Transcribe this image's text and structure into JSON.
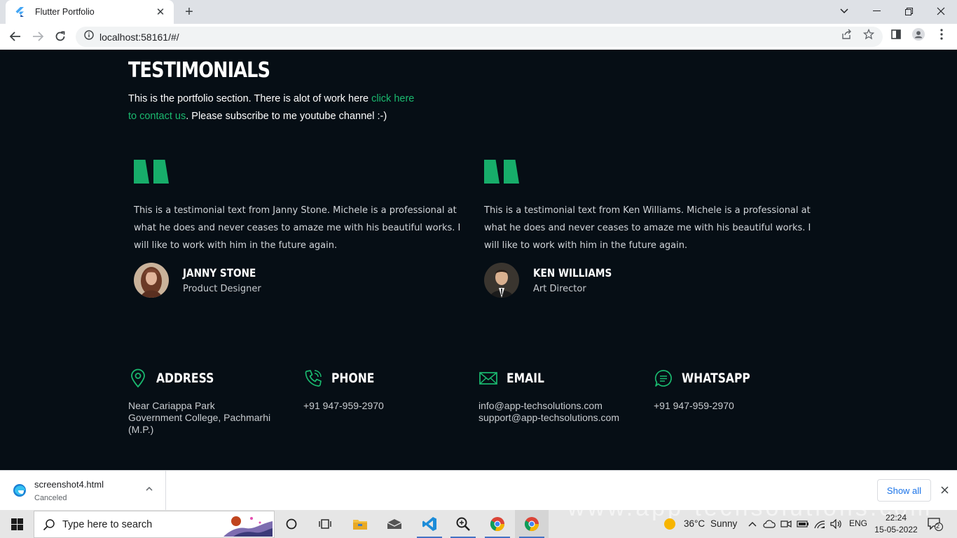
{
  "browser": {
    "tab_title": "Flutter Portfolio",
    "new_tab": "+",
    "url": "localhost:58161/#/"
  },
  "page": {
    "section_title": "TESTIMONIALS",
    "intro_before": "This is the portfolio section. There is alot of work here ",
    "intro_link": "click here to contact us",
    "intro_after": ". Please subscribe to me youtube channel :-)",
    "testimonials": [
      {
        "text": "This is a testimonial text from Janny Stone. Michele is a professional at what he does and never ceases to amaze me with his beautiful works. I will like to work with him in the future again.",
        "name": "JANNY STONE",
        "role": "Product Designer"
      },
      {
        "text": "This is a testimonial text from Ken Williams. Michele is a professional at what he does and never ceases to amaze me with his beautiful works. I will like to work with him in the future again.",
        "name": "KEN WILLIAMS",
        "role": "Art Director"
      }
    ],
    "contacts": [
      {
        "title": "ADDRESS",
        "icon": "location-pin-icon",
        "lines": [
          "Near Cariappa Park",
          "Government College, Pachmarhi (M.P.)"
        ]
      },
      {
        "title": "PHONE",
        "icon": "phone-icon",
        "lines": [
          "+91 947-959-2970"
        ]
      },
      {
        "title": "EMAIL",
        "icon": "mail-icon",
        "lines": [
          "info@app-techsolutions.com",
          "support@app-techsolutions.com"
        ]
      },
      {
        "title": "WHATSAPP",
        "icon": "chat-icon",
        "lines": [
          "+91 947-959-2970"
        ]
      }
    ],
    "accent_color": "#1ab96f",
    "background_color": "#060e15"
  },
  "downloads": {
    "file_name": "screenshot4.html",
    "status": "Canceled",
    "show_all": "Show all"
  },
  "taskbar": {
    "search_placeholder": "Type here to search",
    "watermark": "www.app-techsolutions.com",
    "weather_temp": "36°C",
    "weather_desc": "Sunny",
    "language": "ENG",
    "time": "22:24",
    "date": "15-05-2022",
    "notification_count": "2"
  }
}
